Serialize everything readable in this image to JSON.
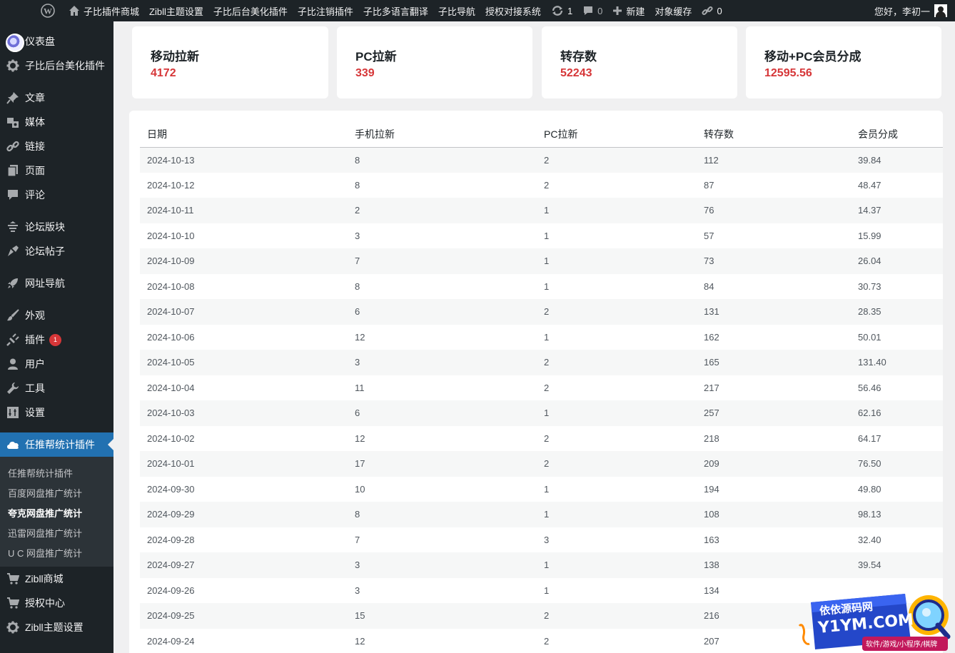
{
  "adminbar": {
    "items": [
      {
        "label": "子比插件商城",
        "icon": "home-icon"
      },
      {
        "label": "Zibll主题设置"
      },
      {
        "label": "子比后台美化插件"
      },
      {
        "label": "子比注销插件"
      },
      {
        "label": "子比多语言翻译"
      },
      {
        "label": "子比导航"
      },
      {
        "label": "授权对接系统"
      }
    ],
    "updates_count": "1",
    "comments_count": "0",
    "new_label": "新建",
    "cache_label": "对象缓存",
    "links_count": "0",
    "greeting": "您好，李初一"
  },
  "sidebar": {
    "items": [
      {
        "label": "仪表盘",
        "icon": "dashboard-icon"
      },
      {
        "label": "子比后台美化插件",
        "icon": "gear-icon"
      },
      {
        "label": "文章",
        "icon": "pin-icon"
      },
      {
        "label": "媒体",
        "icon": "media-icon"
      },
      {
        "label": "链接",
        "icon": "link-icon"
      },
      {
        "label": "页面",
        "icon": "page-icon"
      },
      {
        "label": "评论",
        "icon": "comment-icon"
      },
      {
        "label": "论坛版块",
        "icon": "forum-icon"
      },
      {
        "label": "论坛帖子",
        "icon": "post-icon"
      },
      {
        "label": "网址导航",
        "icon": "rocket-icon"
      },
      {
        "label": "外观",
        "icon": "brush-icon"
      },
      {
        "label": "插件",
        "icon": "plugin-icon",
        "badge": "1"
      },
      {
        "label": "用户",
        "icon": "user-icon"
      },
      {
        "label": "工具",
        "icon": "wrench-icon"
      },
      {
        "label": "设置",
        "icon": "settings-icon"
      },
      {
        "label": "任推帮统计插件",
        "icon": "cloud-icon"
      }
    ],
    "submenu": [
      "任推帮统计插件",
      "百度网盘推广统计",
      "夸克网盘推广统计",
      "迅雷网盘推广统计",
      "U C 网盘推广统计"
    ],
    "after": [
      {
        "label": "Zibll商城",
        "icon": "cart-icon"
      },
      {
        "label": "授权中心",
        "icon": "cart-icon"
      },
      {
        "label": "Zibll主题设置",
        "icon": "gear-icon"
      }
    ]
  },
  "stats": [
    {
      "label": "移动拉新",
      "value": "4172"
    },
    {
      "label": "PC拉新",
      "value": "339"
    },
    {
      "label": "转存数",
      "value": "52243"
    },
    {
      "label": "移动+PC会员分成",
      "value": "12595.56"
    }
  ],
  "table": {
    "headers": [
      "日期",
      "手机拉新",
      "PC拉新",
      "转存数",
      "会员分成"
    ],
    "rows": [
      [
        "2024-10-13",
        "8",
        "2",
        "112",
        "39.84"
      ],
      [
        "2024-10-12",
        "8",
        "2",
        "87",
        "48.47"
      ],
      [
        "2024-10-11",
        "2",
        "1",
        "76",
        "14.37"
      ],
      [
        "2024-10-10",
        "3",
        "1",
        "57",
        "15.99"
      ],
      [
        "2024-10-09",
        "7",
        "1",
        "73",
        "26.04"
      ],
      [
        "2024-10-08",
        "8",
        "1",
        "84",
        "30.73"
      ],
      [
        "2024-10-07",
        "6",
        "2",
        "131",
        "28.35"
      ],
      [
        "2024-10-06",
        "12",
        "1",
        "162",
        "50.01"
      ],
      [
        "2024-10-05",
        "3",
        "2",
        "165",
        "131.40"
      ],
      [
        "2024-10-04",
        "11",
        "2",
        "217",
        "56.46"
      ],
      [
        "2024-10-03",
        "6",
        "1",
        "257",
        "62.16"
      ],
      [
        "2024-10-02",
        "12",
        "2",
        "218",
        "64.17"
      ],
      [
        "2024-10-01",
        "17",
        "2",
        "209",
        "76.50"
      ],
      [
        "2024-09-30",
        "10",
        "1",
        "194",
        "49.80"
      ],
      [
        "2024-09-29",
        "8",
        "1",
        "108",
        "98.13"
      ],
      [
        "2024-09-28",
        "7",
        "3",
        "163",
        "32.40"
      ],
      [
        "2024-09-27",
        "3",
        "1",
        "138",
        "39.54"
      ],
      [
        "2024-09-26",
        "3",
        "1",
        "134",
        ""
      ],
      [
        "2024-09-25",
        "15",
        "2",
        "216",
        ""
      ],
      [
        "2024-09-24",
        "12",
        "2",
        "207",
        ""
      ]
    ]
  },
  "watermark": {
    "line1": "依依源码网",
    "line2": "Y1YM.COM",
    "line3": "软件/游戏/小程序/棋牌"
  }
}
